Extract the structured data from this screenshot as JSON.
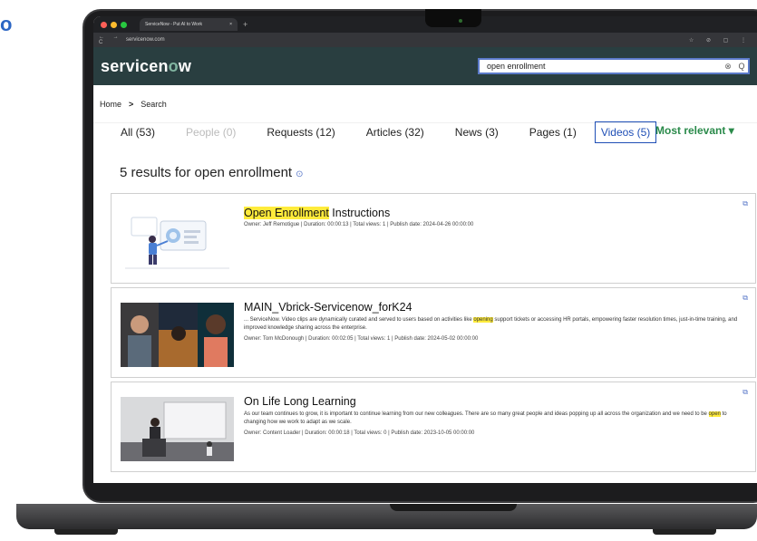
{
  "corner": {
    "text": "o"
  },
  "browser": {
    "tab_title": "ServiceNow - Put AI to Work",
    "tab_close": "×",
    "new_tab": "+",
    "nav_icons": "← → C",
    "url": "servicenow.com",
    "tool_icons": "☆ ⊘ ▢ ⋮"
  },
  "header": {
    "logo_prefix": "servicen",
    "logo_o": "o",
    "logo_suffix": "w",
    "search_value": "open enrollment",
    "clear_glyph": "⊗",
    "search_glyph": "Q"
  },
  "breadcrumb": {
    "home": "Home",
    "separator": ">",
    "current": "Search"
  },
  "filters": {
    "tabs": [
      {
        "label": "All (53)"
      },
      {
        "label": "People (0)"
      },
      {
        "label": "Requests (12)"
      },
      {
        "label": "Articles (32)"
      },
      {
        "label": "News (3)"
      },
      {
        "label": "Pages (1)"
      },
      {
        "label": "Videos (5)"
      }
    ],
    "sort": "Most relevant ▾"
  },
  "results_heading": {
    "text": "5 results for open enrollment",
    "info_glyph": "⊙"
  },
  "results": [
    {
      "title_highlight": "Open Enrollment",
      "title_rest": " Instructions",
      "meta": "Owner: Jeff Remotigue | Duration: 00:00:13 | Total views: 1 | Publish date: 2024-04-26 00:00:00"
    },
    {
      "title": "MAIN_Vbrick-Servicenow_forK24",
      "desc_pre": "... ServiceNow. Video clips are dynamically curated and served to users based on activities like ",
      "desc_hl": "opening",
      "desc_post": " support tickets or accessing HR portals, empowering faster resolution times, just-in-time training, and improved knowledge sharing across the enterprise.",
      "meta": "Owner: Tom McDonough | Duration: 00:02:05 | Total views: 1 | Publish date: 2024-05-02 00:00:00"
    },
    {
      "title": "On Life Long Learning",
      "desc_pre": "As our team continues to grow, it is important to continue learning from our new colleagues. There are so many great people and ideas popping up all across the organization and we need to be ",
      "desc_hl": "open",
      "desc_post": " to changing how we work to adapt as we scale.",
      "meta": "Owner: Content Loader | Duration: 00:00:18 | Total views: 0 | Publish date: 2023-10-05 00:00:00"
    }
  ],
  "ext_glyph": "⧉",
  "colors": {
    "header_bg": "#293e40",
    "accent": "#1f4fb6",
    "highlight": "#ffeb3b",
    "sort": "#2a8a4a"
  }
}
